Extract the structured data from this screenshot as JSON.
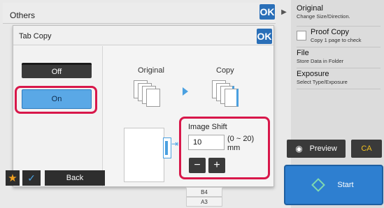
{
  "others": {
    "title": "Others",
    "ok_label": "OK"
  },
  "dialog": {
    "title": "Tab Copy",
    "ok_label": "OK",
    "off_label": "Off",
    "on_label": "On",
    "original_label": "Original",
    "copy_label": "Copy",
    "image_shift_label": "Image Shift",
    "shift_value": "10",
    "shift_range": "(0 ~ 20) mm",
    "minus_label": "−",
    "plus_label": "+"
  },
  "bottom": {
    "back_label": "Back",
    "star_icon": "★",
    "check_icon": "✓",
    "paper_b4": "B4",
    "paper_a3": "A3"
  },
  "right_panel": {
    "items": [
      {
        "title": "Original",
        "sub": "Change Size/Direction."
      },
      {
        "title": "Proof Copy",
        "sub": "Copy 1 page to check"
      },
      {
        "title": "File",
        "sub": "Store Data in Folder"
      },
      {
        "title": "Exposure",
        "sub": "Select Type/Exposure"
      }
    ],
    "preview_label": "Preview",
    "ca_label": "CA",
    "start_label": "Start"
  },
  "colors": {
    "accent": "#2a6fb8",
    "highlight": "#d8174a",
    "on_button": "#5aa8e6",
    "ca_text": "#f0c020"
  }
}
